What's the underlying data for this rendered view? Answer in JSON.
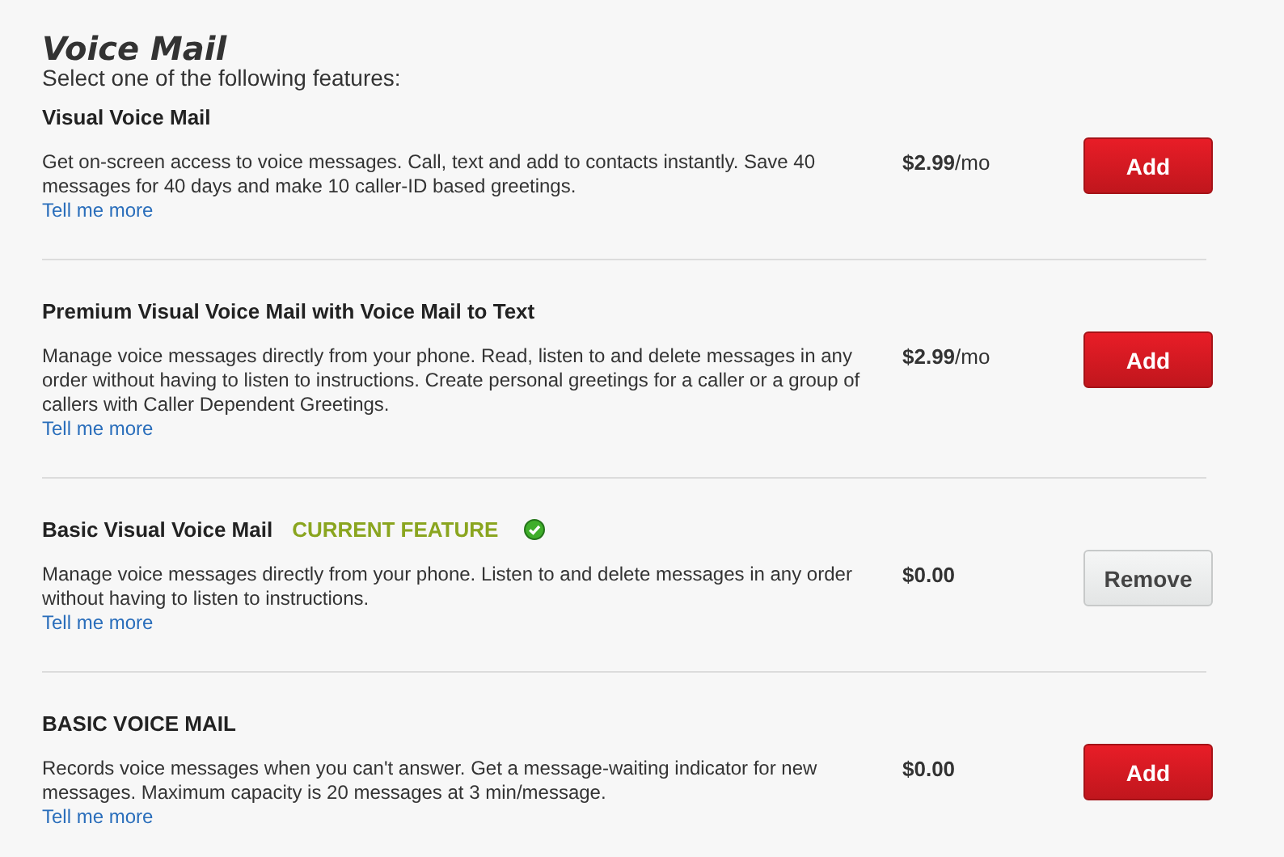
{
  "heading": "Voice Mail",
  "subheading": "Select one of the following features:",
  "features": [
    {
      "name": "Visual Voice Mail",
      "current": false,
      "description": "Get on-screen access to voice messages. Call, text and add to contacts instantly. Save 40 messages for 40 days and make 10 caller-ID based greetings.",
      "link": "Tell me more",
      "price": "$2.99",
      "period": "/mo",
      "action": {
        "label": "Add",
        "kind": "add"
      }
    },
    {
      "name": "Premium Visual Voice Mail with Voice Mail to Text",
      "current": false,
      "description": "Manage voice messages directly from your phone. Read, listen to and delete messages in any order without having to listen to instructions. Create personal greetings for a caller or a group of callers with Caller Dependent Greetings.",
      "link": "Tell me more",
      "price": "$2.99",
      "period": "/mo",
      "action": {
        "label": "Add",
        "kind": "add"
      }
    },
    {
      "name": "Basic Visual Voice Mail",
      "current": true,
      "badge": "CURRENT FEATURE",
      "description": "Manage voice messages directly from your phone. Listen to and delete messages in any order without having to listen to instructions.",
      "link": "Tell me more",
      "price": "$0.00",
      "action": {
        "label": "Remove",
        "kind": "remove"
      }
    },
    {
      "name": "BASIC VOICE MAIL",
      "current": false,
      "description": "Records voice messages when you can't answer. Get a message-waiting indicator for new messages. Maximum capacity is 20 messages at 3 min/message.",
      "link": "Tell me more",
      "price": "$0.00",
      "action": {
        "label": "Add",
        "kind": "add"
      }
    }
  ]
}
